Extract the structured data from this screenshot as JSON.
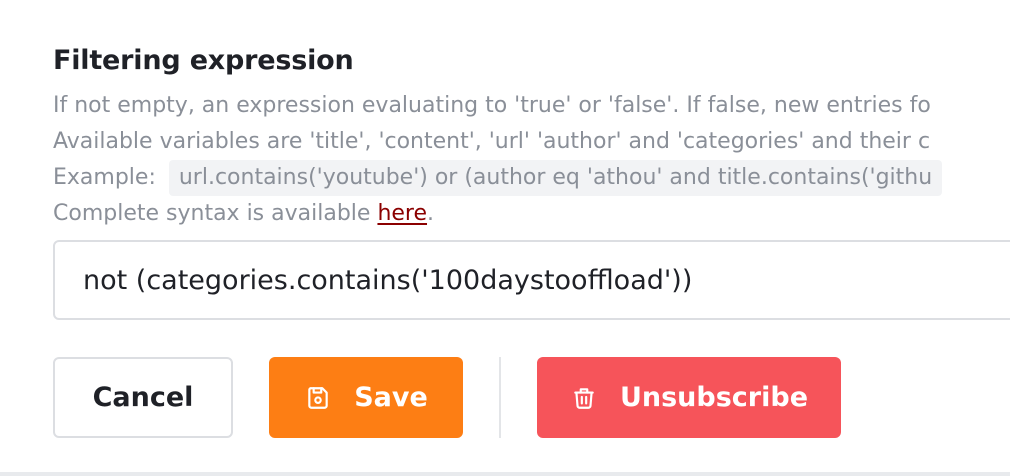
{
  "filter": {
    "label": "Filtering expression",
    "help_line1": "If not empty, an expression evaluating to 'true' or 'false'. If false, new entries fo",
    "help_line2": "Available variables are 'title', 'content', 'url' 'author' and 'categories' and their c",
    "example_prefix": "Example:",
    "example_code": "url.contains('youtube') or (author eq 'athou' and title.contains('githu",
    "syntax_prefix": "Complete syntax is available ",
    "syntax_link": "here",
    "syntax_suffix": ".",
    "value": "not (categories.contains('100daystooffload'))"
  },
  "actions": {
    "cancel_label": "Cancel",
    "save_label": "Save",
    "unsubscribe_label": "Unsubscribe"
  },
  "icons": {
    "save": "floppy-disk-icon",
    "unsubscribe": "trash-icon"
  },
  "colors": {
    "save": "#fd7e14",
    "unsubscribe": "#f6545a",
    "link": "#8b0000",
    "help_text": "#8a8f98"
  }
}
